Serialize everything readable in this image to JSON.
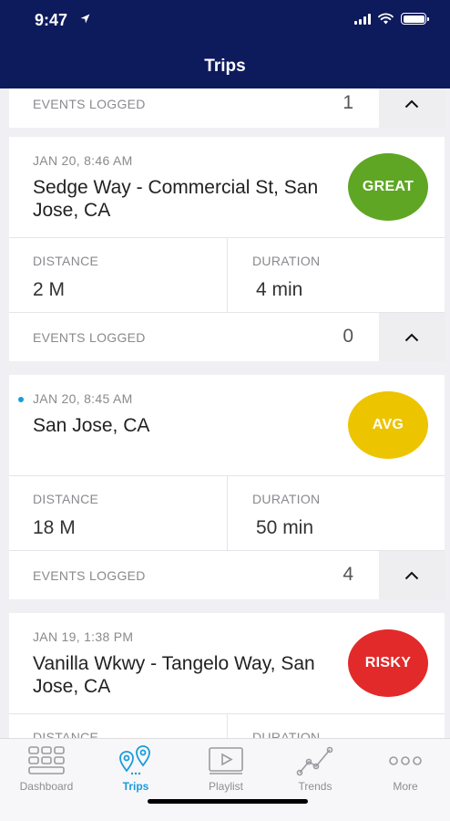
{
  "status_bar": {
    "time": "9:47"
  },
  "nav": {
    "title": "Trips"
  },
  "clipped_card": {
    "events_label": "EVENTS LOGGED",
    "events_count": "1"
  },
  "trips": [
    {
      "datetime": "JAN 20, 8:46 AM",
      "title": "Sedge Way - Commercial St, San Jose, CA",
      "rating": "GREAT",
      "rating_color": "#5fa624",
      "distance_label": "DISTANCE",
      "distance": "2 M",
      "duration_label": "DURATION",
      "duration": "4 min",
      "events_label": "EVENTS LOGGED",
      "events_count": "0",
      "unread": false
    },
    {
      "datetime": "JAN 20, 8:45 AM",
      "title": "San Jose, CA",
      "rating": "AVG",
      "rating_color": "#ecc400",
      "distance_label": "DISTANCE",
      "distance": "18 M",
      "duration_label": "DURATION",
      "duration": "50 min",
      "events_label": "EVENTS LOGGED",
      "events_count": "4",
      "unread": true
    },
    {
      "datetime": "JAN 19, 1:38 PM",
      "title": "Vanilla Wkwy - Tangelo Way, San Jose, CA",
      "rating": "RISKY",
      "rating_color": "#e22a2a",
      "distance_label": "DISTANCE",
      "duration_label": "DURATION",
      "unread": false
    }
  ],
  "tabbar": {
    "tabs": [
      {
        "label": "Dashboard",
        "icon": "dashboard-grid-icon"
      },
      {
        "label": "Trips",
        "icon": "map-pins-icon",
        "active": true
      },
      {
        "label": "Playlist",
        "icon": "video-play-icon"
      },
      {
        "label": "Trends",
        "icon": "trend-line-icon"
      },
      {
        "label": "More",
        "icon": "more-dots-icon"
      }
    ]
  },
  "colors": {
    "header_bg": "#0d1a5c",
    "accent": "#1a9bdc"
  }
}
